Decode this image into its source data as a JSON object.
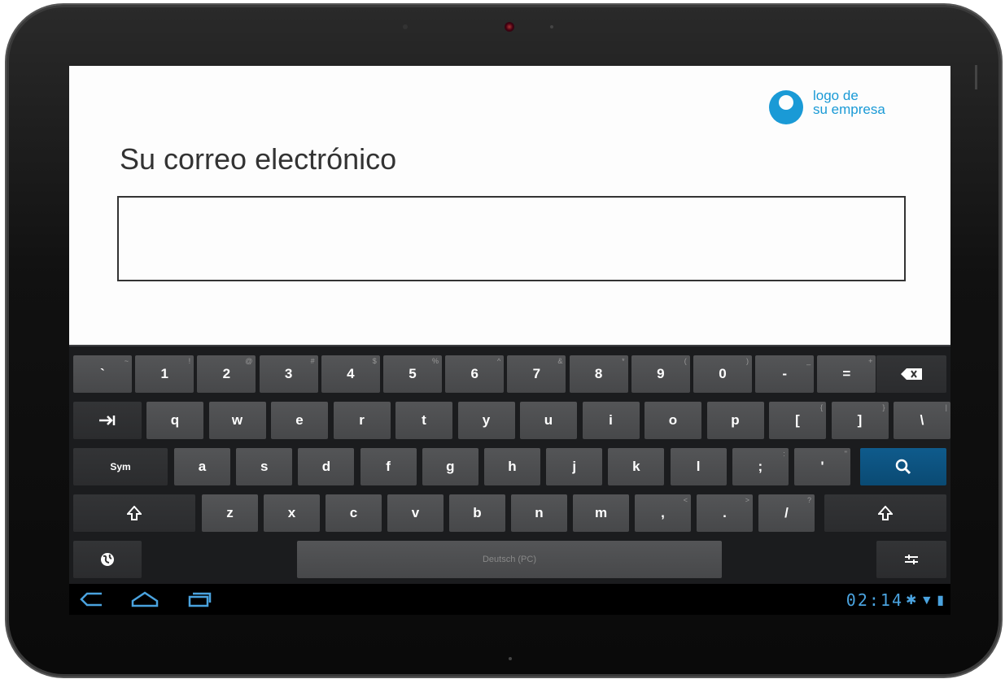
{
  "logo": {
    "line1": "logo de",
    "line2": "su empresa"
  },
  "form": {
    "title": "Su correo electrónico",
    "email_value": ""
  },
  "keyboard": {
    "row1": [
      {
        "k": "`",
        "h": "~"
      },
      {
        "k": "1",
        "h": "!"
      },
      {
        "k": "2",
        "h": "@"
      },
      {
        "k": "3",
        "h": "#"
      },
      {
        "k": "4",
        "h": "$"
      },
      {
        "k": "5",
        "h": "%"
      },
      {
        "k": "6",
        "h": "^"
      },
      {
        "k": "7",
        "h": "&"
      },
      {
        "k": "8",
        "h": "*"
      },
      {
        "k": "9",
        "h": "("
      },
      {
        "k": "0",
        "h": ")"
      },
      {
        "k": "-",
        "h": "_"
      },
      {
        "k": "=",
        "h": "+"
      }
    ],
    "row2": [
      {
        "k": "q",
        "h": ""
      },
      {
        "k": "w",
        "h": ""
      },
      {
        "k": "e",
        "h": ""
      },
      {
        "k": "r",
        "h": ""
      },
      {
        "k": "t",
        "h": ""
      },
      {
        "k": "y",
        "h": ""
      },
      {
        "k": "u",
        "h": ""
      },
      {
        "k": "i",
        "h": ""
      },
      {
        "k": "o",
        "h": ""
      },
      {
        "k": "p",
        "h": ""
      },
      {
        "k": "[",
        "h": "{"
      },
      {
        "k": "]",
        "h": "}"
      },
      {
        "k": "\\",
        "h": "|"
      }
    ],
    "row3": [
      {
        "k": "a",
        "h": ""
      },
      {
        "k": "s",
        "h": ""
      },
      {
        "k": "d",
        "h": ""
      },
      {
        "k": "f",
        "h": ""
      },
      {
        "k": "g",
        "h": ""
      },
      {
        "k": "h",
        "h": ""
      },
      {
        "k": "j",
        "h": ""
      },
      {
        "k": "k",
        "h": ""
      },
      {
        "k": "l",
        "h": ""
      },
      {
        "k": ";",
        "h": ":"
      },
      {
        "k": "'",
        "h": "\""
      }
    ],
    "row4": [
      {
        "k": "z",
        "h": ""
      },
      {
        "k": "x",
        "h": ""
      },
      {
        "k": "c",
        "h": ""
      },
      {
        "k": "v",
        "h": ""
      },
      {
        "k": "b",
        "h": ""
      },
      {
        "k": "n",
        "h": ""
      },
      {
        "k": "m",
        "h": ""
      },
      {
        "k": ",",
        "h": "<"
      },
      {
        "k": ".",
        "h": ">"
      },
      {
        "k": "/",
        "h": "?"
      }
    ],
    "sym_label": "Sym",
    "space_label": "Deutsch (PC)"
  },
  "statusbar": {
    "clock": "02:14"
  }
}
